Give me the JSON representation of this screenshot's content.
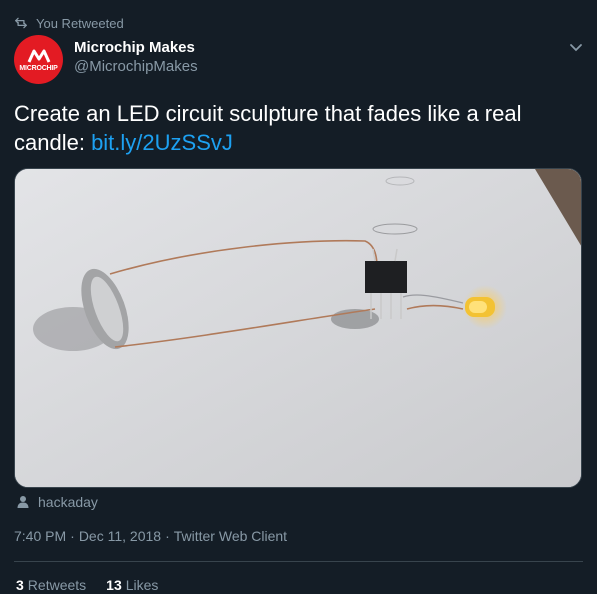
{
  "retweet_context": {
    "text": "You Retweeted",
    "icon": "retweet-icon"
  },
  "author": {
    "display_name": "Microchip Makes",
    "handle": "@MicrochipMakes",
    "avatar_wordmark": "MICROCHIP",
    "avatar_color": "#e31b23"
  },
  "tweet": {
    "text": "Create an LED circuit sculpture that fades like a real candle: ",
    "link_text": "bit.ly/2UzSSvJ"
  },
  "media": {
    "credit": "hackaday",
    "credit_icon": "user-icon"
  },
  "meta": {
    "time": "7:40 PM",
    "date": "Dec 11, 2018",
    "client": "Twitter Web Client",
    "separator": "·"
  },
  "stats": {
    "retweets_count": "3",
    "retweets_label": "Retweets",
    "likes_count": "13",
    "likes_label": "Likes"
  },
  "colors": {
    "background": "#141d26",
    "text_primary": "#ffffff",
    "text_secondary": "#8899a6",
    "link": "#1da1f2",
    "border": "#38444d"
  }
}
